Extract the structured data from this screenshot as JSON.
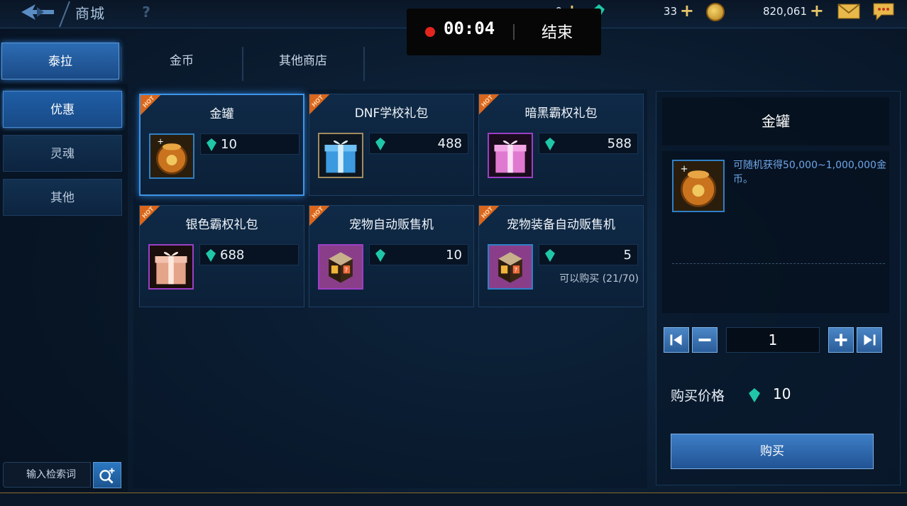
{
  "header": {
    "title": "商城",
    "help_label": "?",
    "currency_1": "0",
    "currency_2": "33",
    "gold": "820,061",
    "plus_label": "+"
  },
  "recording": {
    "time": "00:04",
    "end_label": "结束"
  },
  "tabs": [
    {
      "label": "泰拉"
    },
    {
      "label": "金币"
    },
    {
      "label": "其他商店"
    }
  ],
  "categories": [
    {
      "label": "优惠"
    },
    {
      "label": "灵魂"
    },
    {
      "label": "其他"
    }
  ],
  "search": {
    "placeholder": "输入检索词"
  },
  "items": [
    {
      "name": "金罐",
      "price": "10",
      "hot": "HOT"
    },
    {
      "name": "DNF学校礼包",
      "price": "488",
      "hot": "HOT"
    },
    {
      "name": "暗黑霸权礼包",
      "price": "588",
      "hot": "HOT"
    },
    {
      "name": "银色霸权礼包",
      "price": "688",
      "hot": "HOT"
    },
    {
      "name": "宠物自动贩售机",
      "price": "10",
      "hot": "HOT"
    },
    {
      "name": "宠物装备自动贩售机",
      "price": "5",
      "hot": "HOT",
      "limit": "可以购买 (21/70)"
    }
  ],
  "detail": {
    "title": "金罐",
    "description": "可随机获得50,000~1,000,000金币。",
    "quantity": "1",
    "price_label": "购买价格",
    "price": "10",
    "buy_label": "购买"
  },
  "colors": {
    "accent": "#2f7fc6",
    "hot": "#d9661c",
    "gem": "#1fc7a8",
    "gold": "#e7c66b"
  }
}
